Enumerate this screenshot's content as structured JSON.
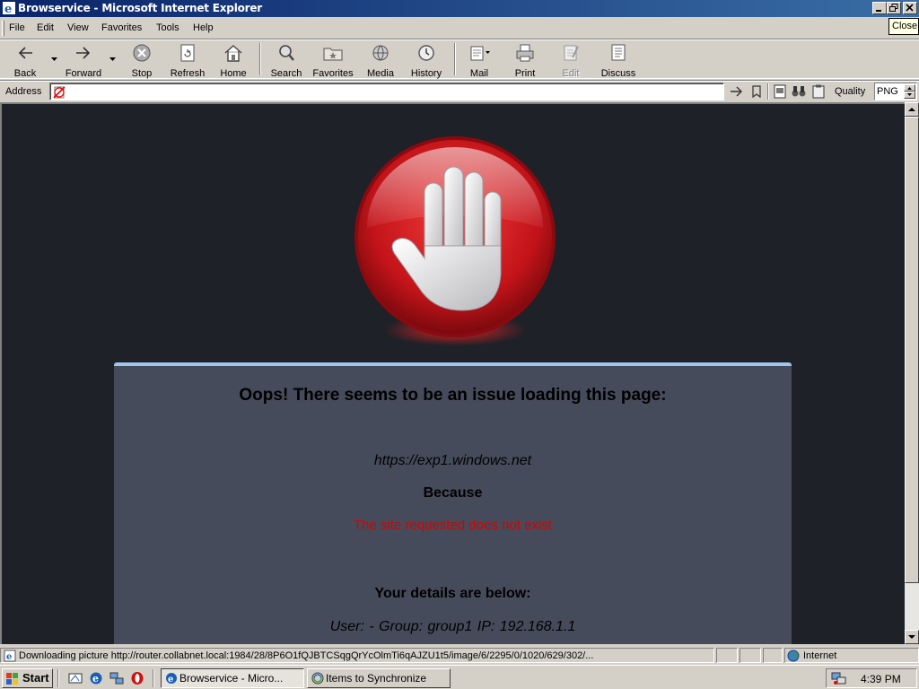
{
  "window": {
    "title": "Browservice - Microsoft Internet Explorer",
    "close_tooltip": "Close"
  },
  "menu": {
    "items": [
      "File",
      "Edit",
      "View",
      "Favorites",
      "Tools",
      "Help"
    ]
  },
  "toolbar": {
    "back": "Back",
    "forward": "Forward",
    "stop": "Stop",
    "refresh": "Refresh",
    "home": "Home",
    "search": "Search",
    "favorites": "Favorites",
    "media": "Media",
    "history": "History",
    "mail": "Mail",
    "print": "Print",
    "edit": "Edit",
    "discuss": "Discuss"
  },
  "address_bar": {
    "label": "Address",
    "value": "",
    "quality_label": "Quality",
    "quality_value": "PNG"
  },
  "page": {
    "heading": "Oops! There seems to be an issue loading this page:",
    "url": "https://exp1.windows.net",
    "because": "Because",
    "reason": "The site requested does not exist",
    "details_heading": "Your details are below:",
    "user_line": "User: -   Group: group1   IP: 192.168.1.1",
    "colors": {
      "background": "#1e2128",
      "panel": "#454b5a",
      "panel_border": "#9fc6ec",
      "reason_text": "#d80000"
    }
  },
  "status_bar": {
    "text": "Downloading picture http://router.collabnet.local:1984/28/8P6O1fQJBTCSqgQrYcOlmTi6qAJZU1t5/image/6/2295/0/1020/629/302/...",
    "zone": "Internet"
  },
  "taskbar": {
    "start_label": "Start",
    "tasks": [
      {
        "label": "Browservice - Micro...",
        "active": true
      },
      {
        "label": "Items to Synchronize",
        "active": false
      }
    ],
    "clock": "4:39 PM"
  },
  "icons": {
    "stop_hand": "stop-hand-icon",
    "page_icon": "broken-page-icon"
  }
}
